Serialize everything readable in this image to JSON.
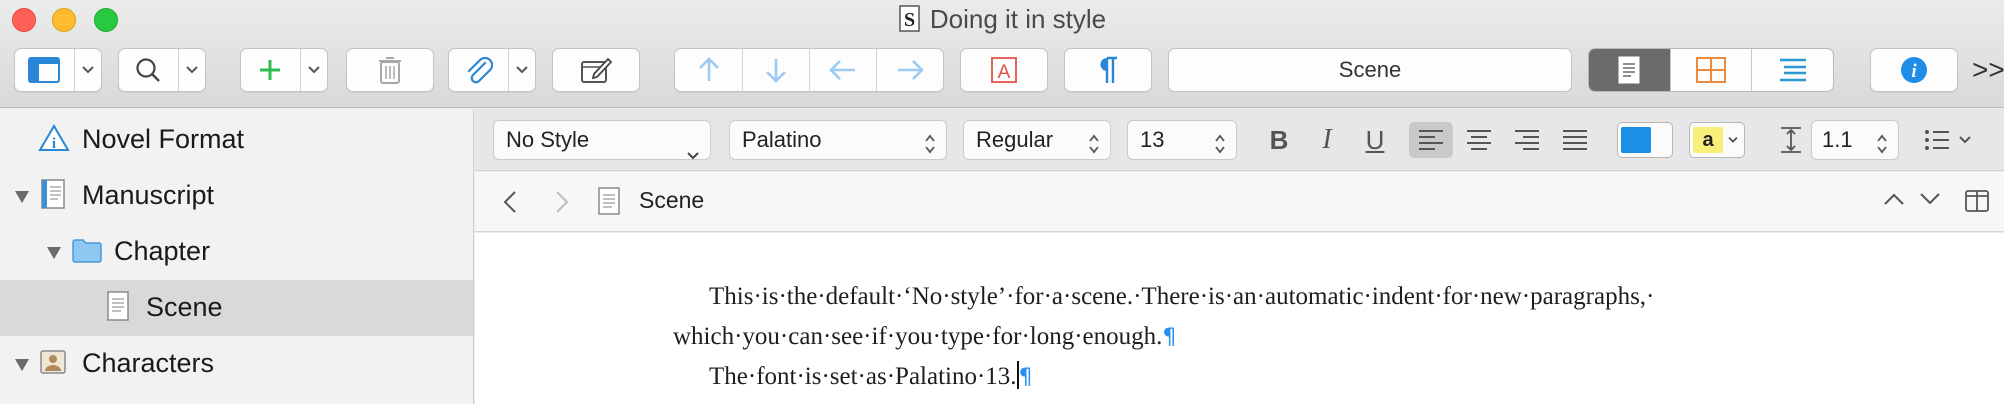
{
  "window": {
    "title": "Doing it in style"
  },
  "toolbar": {
    "scene_field": "Scene",
    "overflow_label": ">>"
  },
  "binder": {
    "items": [
      {
        "label": "Novel Format"
      },
      {
        "label": "Manuscript"
      },
      {
        "label": "Chapter"
      },
      {
        "label": "Scene"
      },
      {
        "label": "Characters"
      }
    ]
  },
  "format_bar": {
    "style": "No Style",
    "font": "Palatino",
    "weight": "Regular",
    "size": "13",
    "bold_label": "B",
    "italic_label": "I",
    "underline_label": "U",
    "highlight_label": "a",
    "line_spacing": "1.1",
    "text_color": "#1a8fe6",
    "highlight_color": "#f7ef7a"
  },
  "editor": {
    "header_title": "Scene",
    "paragraph1_line1": "This·is·the·default·‘No·style’·for·a·scene.·There·is·an·automatic·indent·for·new·paragraphs,·",
    "paragraph1_line2": "which·you·can·see·if·you·type·for·long·enough.",
    "paragraph2": "The·font·is·set·as·Palatino·13.",
    "pilcrow": "¶"
  }
}
